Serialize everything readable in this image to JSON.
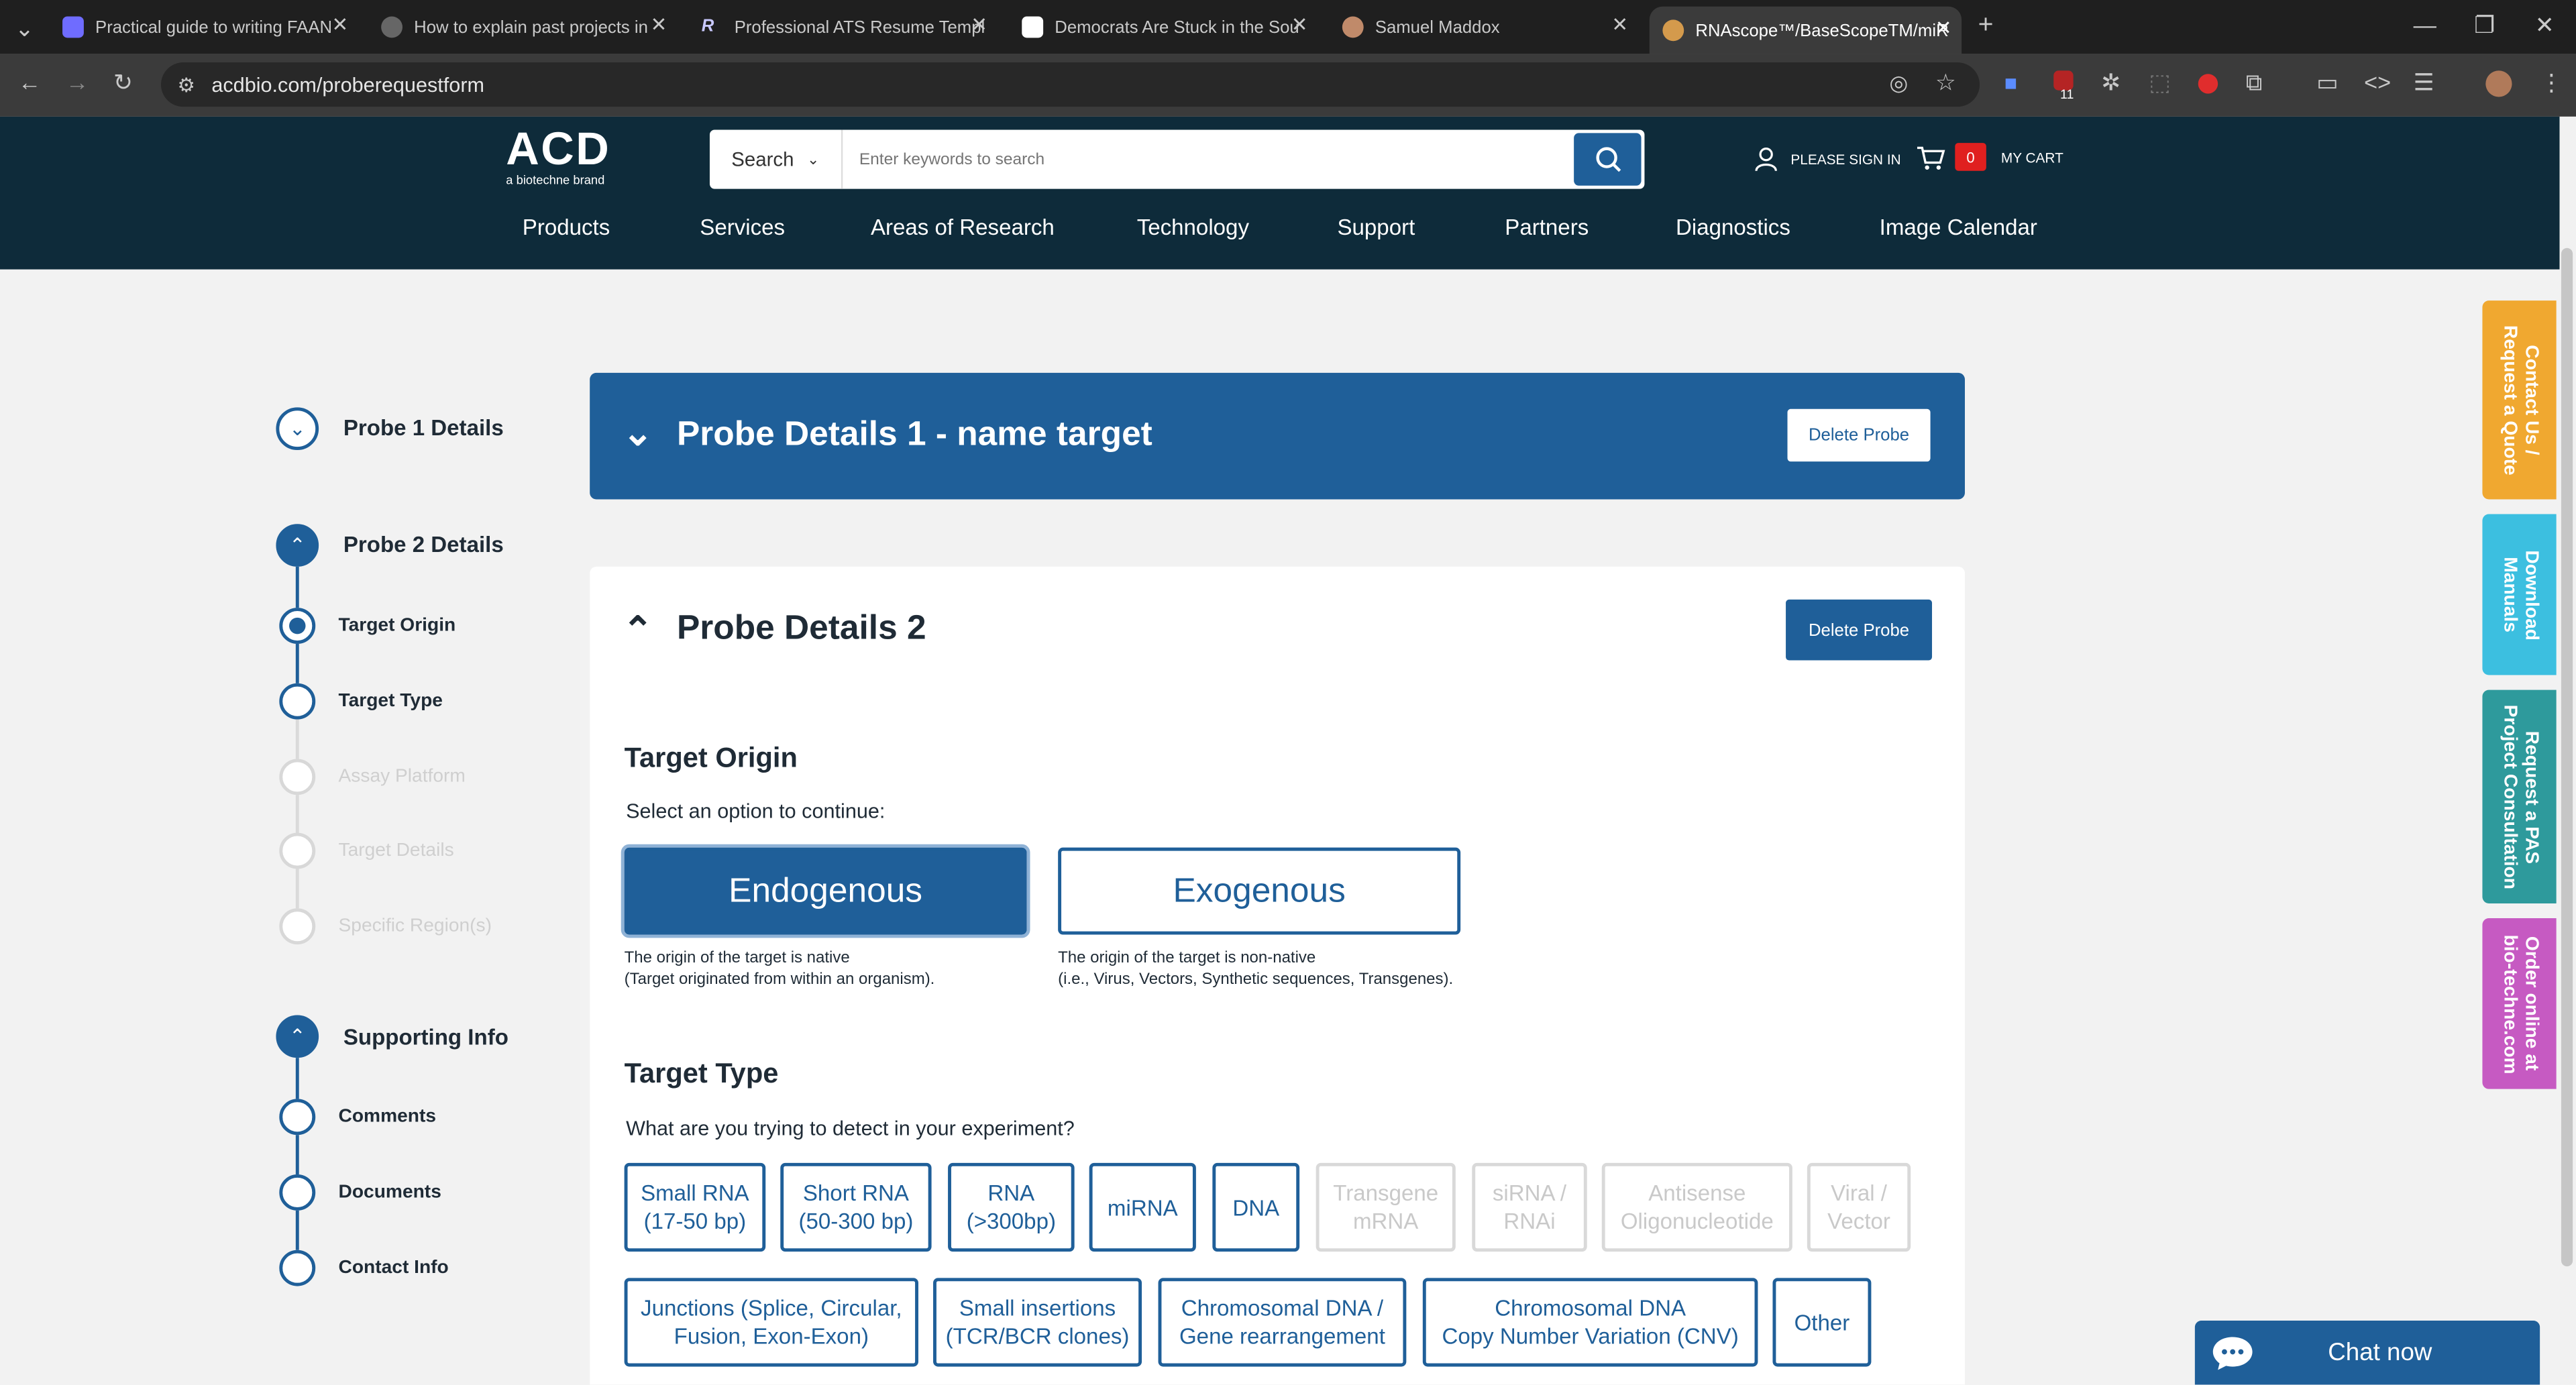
{
  "browser": {
    "tabs": [
      {
        "title": "Practical guide to writing FAAN",
        "favicon_color": "#6f6cff"
      },
      {
        "title": "How to explain past projects in",
        "favicon_color": "#666666"
      },
      {
        "title": "Professional ATS Resume Templ",
        "favicon_color": "#5a4bff"
      },
      {
        "title": "Democrats Are Stuck in the Sou",
        "favicon_color": "#ffffff"
      },
      {
        "title": "Samuel Maddox",
        "favicon_color": "#c08a6a"
      },
      {
        "title": "RNAscope™/BaseScopeTM/miR",
        "favicon_color": "#d49a4c"
      }
    ],
    "url": "acdbio.com/proberequestform",
    "ext_badge": "11"
  },
  "header": {
    "logo_text": "ACD",
    "logo_tagline": "a biotechne brand",
    "search_label": "Search",
    "search_placeholder": "Enter keywords to search",
    "sign_in": "PLEASE SIGN IN",
    "cart_count": "0",
    "cart_label": "MY CART",
    "nav": [
      "Products",
      "Services",
      "Areas of Research",
      "Technology",
      "Support",
      "Partners",
      "Diagnostics",
      "Image Calendar"
    ]
  },
  "stepper": {
    "probe1": "Probe 1 Details",
    "probe2": "Probe 2 Details",
    "probe2_steps": [
      "Target Origin",
      "Target Type",
      "Assay Platform",
      "Target Details",
      "Specific Region(s)"
    ],
    "supporting": "Supporting Info",
    "supporting_steps": [
      "Comments",
      "Documents",
      "Contact Info"
    ]
  },
  "panel1": {
    "title": "Probe Details 1 - name target",
    "delete": "Delete Probe"
  },
  "panel2": {
    "title": "Probe Details 2",
    "delete": "Delete Probe",
    "origin": {
      "heading": "Target Origin",
      "prompt": "Select an option to continue:",
      "options": [
        {
          "label": "Endogenous",
          "desc": "The origin of the target is native\n(Target originated from within an organism)."
        },
        {
          "label": "Exogenous",
          "desc": "The origin of the target is non-native\n(i.e., Virus, Vectors, Synthetic sequences, Transgenes)."
        }
      ]
    },
    "type": {
      "heading": "Target Type",
      "prompt": "What are you trying to detect in your experiment?",
      "row1": [
        "Small RNA\n(17-50 bp)",
        "Short RNA\n(50-300 bp)",
        "RNA\n(>300bp)",
        "miRNA",
        "DNA",
        "Transgene\nmRNA",
        "siRNA /\nRNAi",
        "Antisense\nOligonucleotide",
        "Viral /\nVector"
      ],
      "row2": [
        "Junctions (Splice, Circular,\nFusion, Exon-Exon)",
        "Small insertions\n(TCR/BCR clones)",
        "Chromosomal DNA /\nGene rearrangement",
        "Chromosomal DNA\nCopy Number Variation (CNV)",
        "Other"
      ]
    }
  },
  "side_tabs": [
    {
      "label": "Contact Us /\nRequest a Quote",
      "color": "#f0a830"
    },
    {
      "label": "Download\nManuals",
      "color": "#3cbfe0"
    },
    {
      "label": "Request a PAS\nProject Consultation",
      "color": "#2e9a9c"
    },
    {
      "label": "Order online at\nbio-techne.com",
      "color": "#c65ac2"
    }
  ],
  "chat": {
    "label": "Chat now"
  }
}
